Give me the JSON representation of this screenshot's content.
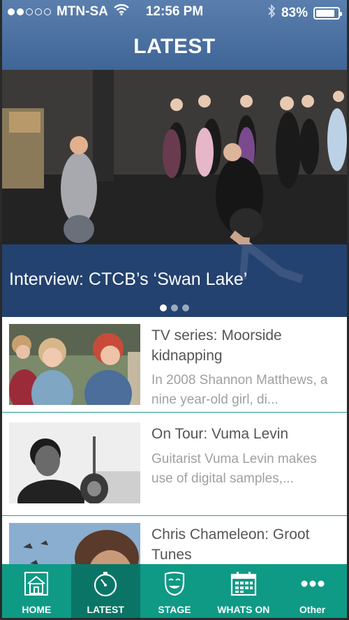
{
  "status_bar": {
    "carrier": "MTN-SA",
    "time": "12:56 PM",
    "battery": "83%",
    "battery_level": 0.83,
    "signal_filled": 2,
    "signal_total": 5,
    "icons": [
      "wifi-icon",
      "bluetooth-icon",
      "battery-icon"
    ]
  },
  "nav": {
    "title": "LATEST"
  },
  "hero": {
    "title": "Interview: CTCB’s ‘Swan Lake’",
    "page_count": 3,
    "active_page": 1
  },
  "articles": [
    {
      "title": "TV series: Moorside kidnapping",
      "excerpt": "In 2008 Shannon Matthews, a nine year-old girl, di..."
    },
    {
      "title": "On Tour: Vuma Levin",
      "excerpt": "Guitarist Vuma Levin makes use of digital samples,..."
    },
    {
      "title": "Chris Chameleon: Groot Tunes",
      "excerpt": ""
    }
  ],
  "tabs": [
    {
      "label": "HOME",
      "icon": "home-icon",
      "active": false
    },
    {
      "label": "LATEST",
      "icon": "stopwatch-icon",
      "active": true
    },
    {
      "label": "STAGE",
      "icon": "theatre-mask-icon",
      "active": false
    },
    {
      "label": "WHATS ON",
      "icon": "calendar-icon",
      "active": false
    },
    {
      "label": "Other",
      "icon": "more-icon",
      "active": false
    }
  ],
  "colors": {
    "nav_bar": "#3f6597",
    "tab_bar": "#0f9a86",
    "tab_active": "#0a7566",
    "divider": "#2a9d8f"
  }
}
